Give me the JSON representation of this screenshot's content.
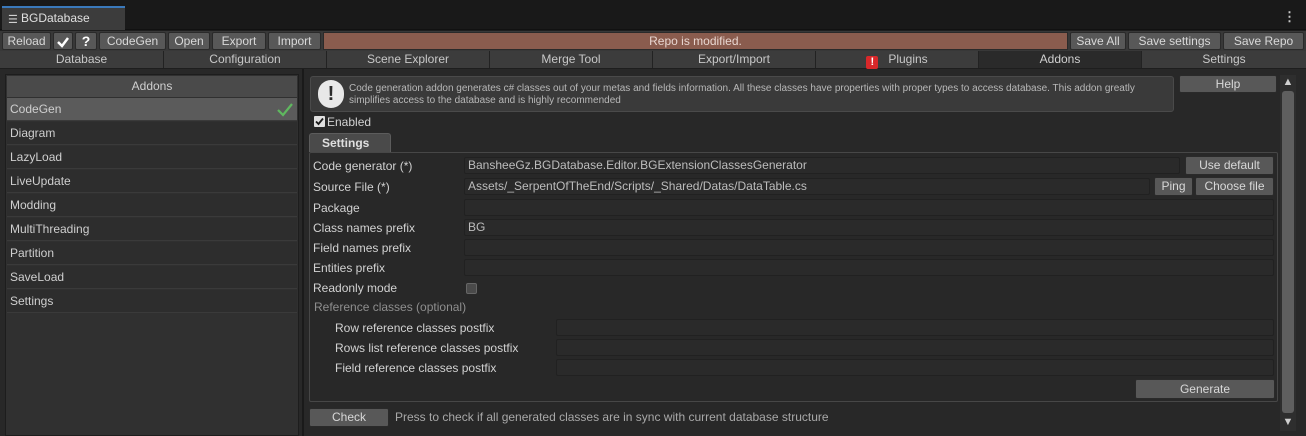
{
  "window": {
    "title": "BGDatabase",
    "menu_icon": "hamburger-icon",
    "more_icon": "vertical-dots-icon"
  },
  "toolbar": {
    "reload": "Reload",
    "check_icon": "checkmark-icon",
    "help_icon": "question-icon",
    "codegen": "CodeGen",
    "open": "Open",
    "export": "Export",
    "import": "Import",
    "status": "Repo is modified.",
    "save_all": "Save All",
    "save_settings": "Save settings",
    "save_repo": "Save Repo"
  },
  "tabs": [
    {
      "label": "Database"
    },
    {
      "label": "Configuration"
    },
    {
      "label": "Scene Explorer"
    },
    {
      "label": "Merge Tool"
    },
    {
      "label": "Export/Import"
    },
    {
      "label": "Plugins",
      "icon": "exclamation-icon"
    },
    {
      "label": "Addons",
      "active": true
    },
    {
      "label": "Settings"
    }
  ],
  "sidebar": {
    "header": "Addons",
    "items": [
      {
        "label": "CodeGen",
        "selected": true,
        "icon": "checkmark-icon"
      },
      {
        "label": "Diagram"
      },
      {
        "label": "LazyLoad"
      },
      {
        "label": "LiveUpdate"
      },
      {
        "label": "Modding"
      },
      {
        "label": "MultiThreading"
      },
      {
        "label": "Partition"
      },
      {
        "label": "SaveLoad"
      },
      {
        "label": "Settings"
      }
    ]
  },
  "main": {
    "info_icon": "info-exclamation-icon",
    "info_text": "Code generation addon generates c# classes out of your metas and fields information. All these classes have properties with proper types to access database. This addon greatly simplifies access to the database and is highly recommended",
    "help": "Help",
    "enabled_label": "Enabled",
    "enabled": true,
    "settings_tab": "Settings",
    "fields": {
      "code_generator": {
        "label": "Code generator (*)",
        "value": "BansheeGz.BGDatabase.Editor.BGExtensionClassesGenerator",
        "button": "Use default"
      },
      "source_file": {
        "label": "Source File (*)",
        "value": "Assets/_SerpentOfTheEnd/Scripts/_Shared/Datas/DataTable.cs",
        "ping": "Ping",
        "choose": "Choose file"
      },
      "package": {
        "label": "Package",
        "value": ""
      },
      "class_prefix": {
        "label": "Class names prefix",
        "value": "BG"
      },
      "field_prefix": {
        "label": "Field names prefix",
        "value": ""
      },
      "entities_prefix": {
        "label": "Entities prefix",
        "value": ""
      },
      "readonly": {
        "label": "Readonly mode",
        "checked": false
      }
    },
    "reference_header": "Reference classes (optional)",
    "reference": {
      "row": {
        "label": "Row reference classes postfix",
        "value": ""
      },
      "rows_list": {
        "label": "Rows list reference classes postfix",
        "value": ""
      },
      "field": {
        "label": "Field reference classes postfix",
        "value": ""
      }
    },
    "generate": "Generate",
    "check": "Check",
    "check_hint": "Press to check if all generated classes are in sync with current database structure"
  },
  "colors": {
    "status_bar": "#8a5c4e",
    "accent_check": "#5fb85f",
    "error_red": "#d9282a"
  }
}
